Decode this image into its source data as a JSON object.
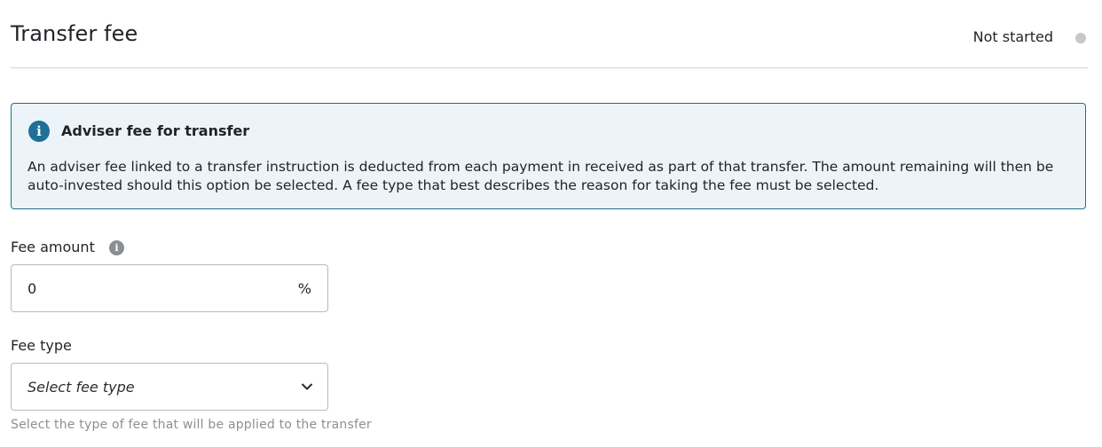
{
  "header": {
    "title": "Transfer fee",
    "status": "Not started",
    "status_dot_color": "#c6c8cc"
  },
  "info_box": {
    "icon": "info-icon",
    "icon_glyph": "i",
    "title": "Adviser fee for transfer",
    "body": "An adviser fee linked to a transfer instruction is deducted from each payment in received as part of that transfer. The amount remaining will then be auto-invested should this option be selected. A fee type that best describes the reason for taking the fee must be selected.",
    "accent_color": "#1f6f99"
  },
  "fee_amount": {
    "label": "Fee amount",
    "info_icon": "info-icon",
    "info_glyph": "i",
    "value": "0",
    "suffix": "%"
  },
  "fee_type": {
    "label": "Fee type",
    "placeholder": "Select fee type",
    "dropdown_icon": "chevron-down-icon",
    "hint": "Select the type of fee that will be applied to the transfer"
  }
}
